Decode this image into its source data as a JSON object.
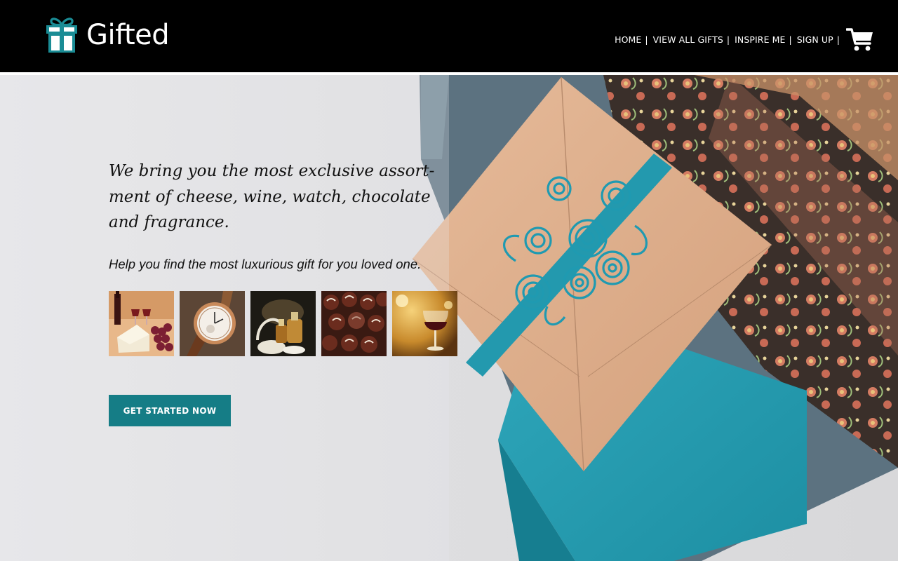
{
  "brand": {
    "name": "Gifted",
    "icon": "gift-box-icon",
    "accent_color": "#1a8c95"
  },
  "nav": {
    "items": [
      {
        "label": "HOME"
      },
      {
        "label": "VIEW ALL GIFTS"
      },
      {
        "label": "INSPIRE ME"
      },
      {
        "label": "SIGN UP"
      }
    ],
    "separator": "|",
    "cart_icon": "shopping-cart-icon"
  },
  "hero": {
    "headline": "We bring you the most exclusive assort-ment of cheese, wine, watch, chocolate and fragrance.",
    "subline": "Help you find the most luxurious gift for you loved one.",
    "thumbnails": [
      {
        "icon": "cheese-wine-photo"
      },
      {
        "icon": "watch-photo"
      },
      {
        "icon": "fragrance-photo"
      },
      {
        "icon": "chocolate-photo"
      },
      {
        "icon": "wine-glass-photo"
      }
    ],
    "cta_label": "GET STARTED NOW",
    "cta_color": "#157d86",
    "background_image": "wrapped-gift-box-photo"
  }
}
